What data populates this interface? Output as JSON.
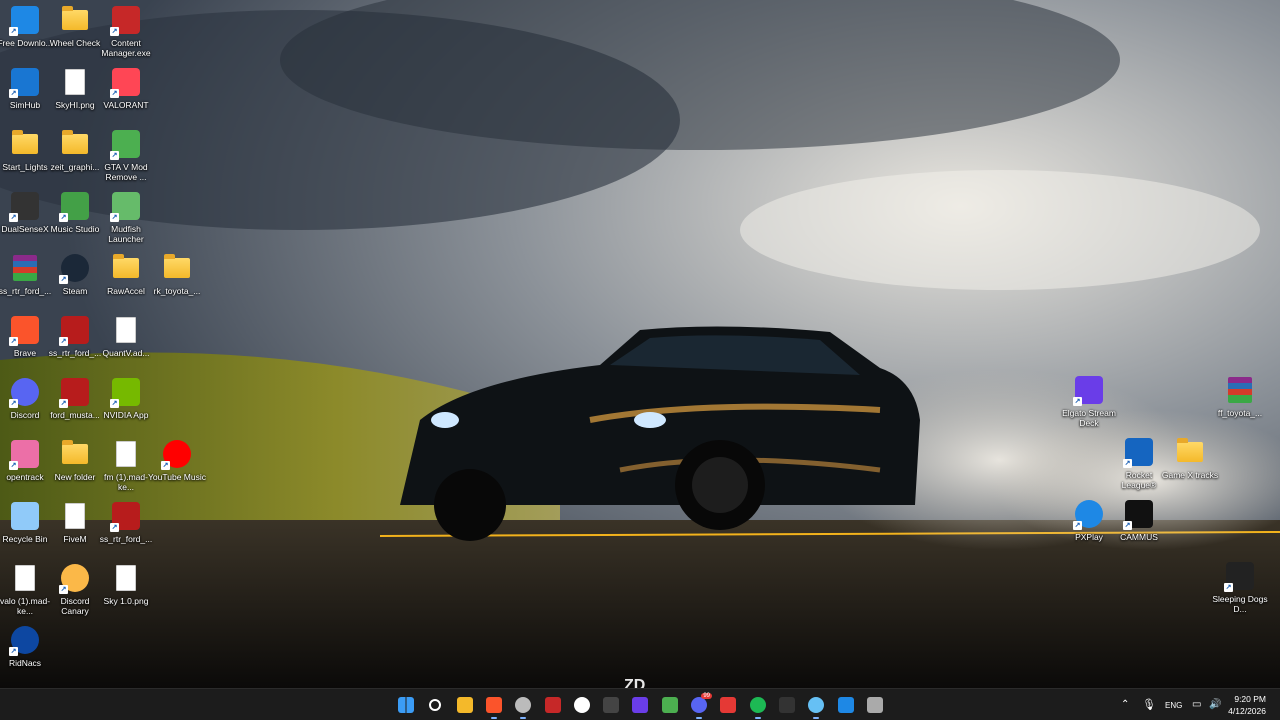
{
  "desktop": {
    "icons": [
      {
        "label": "Free Downlo...",
        "icon": "free-download-manager-icon",
        "color": "#1e88e5"
      },
      {
        "label": "Wheel Check",
        "icon": "folder-icon",
        "color": "#f4b92a"
      },
      {
        "label": "Content Manager.exe",
        "icon": "content-manager-icon",
        "color": "#c62828"
      },
      {
        "label": "SimHub",
        "icon": "simhub-icon",
        "color": "#1976d2"
      },
      {
        "label": "SkyHI.png",
        "icon": "image-file-icon",
        "color": "#ffffff"
      },
      {
        "label": "VALORANT",
        "icon": "valorant-icon",
        "color": "#ff4655"
      },
      {
        "label": "Start_Lights",
        "icon": "folder-icon",
        "color": "#f4b92a"
      },
      {
        "label": "zeit_graphi...",
        "icon": "folder-icon",
        "color": "#f4b92a"
      },
      {
        "label": "GTA V Mod Remove ...",
        "icon": "gta-v-mod-icon",
        "color": "#4caf50"
      },
      {
        "label": "DualSenseX",
        "icon": "dualsensex-icon",
        "color": "#333333"
      },
      {
        "label": "Music Studio",
        "icon": "music-studio-icon",
        "color": "#43a047"
      },
      {
        "label": "Mudfish Launcher",
        "icon": "mudfish-icon",
        "color": "#66bb6a"
      },
      {
        "label": "ss_rtr_ford_...",
        "icon": "winrar-archive-icon",
        "color": "#8b2a8a"
      },
      {
        "label": "Steam",
        "icon": "steam-icon",
        "color": "#1b2838"
      },
      {
        "label": "RawAccel",
        "icon": "folder-icon",
        "color": "#f4b92a"
      },
      {
        "label": "rk_toyota_...",
        "icon": "folder-icon",
        "color": "#f4b92a"
      },
      {
        "label": "Brave",
        "icon": "brave-icon",
        "color": "#fb542b"
      },
      {
        "label": "ss_rtr_ford_...",
        "icon": "kns-file-icon",
        "color": "#b71c1c"
      },
      {
        "label": "QuantV.ad...",
        "icon": "document-icon",
        "color": "#ffffff"
      },
      {
        "label": "Discord",
        "icon": "discord-icon",
        "color": "#5865f2"
      },
      {
        "label": "ford_musta...",
        "icon": "kns-file-icon",
        "color": "#b71c1c"
      },
      {
        "label": "NVIDIA App",
        "icon": "nvidia-icon",
        "color": "#76b900"
      },
      {
        "label": "opentrack",
        "icon": "opentrack-icon",
        "color": "#ec6fa7"
      },
      {
        "label": "New folder",
        "icon": "folder-icon",
        "color": "#f4b92a"
      },
      {
        "label": "fm (1).mad-ke...",
        "icon": "document-icon",
        "color": "#ffffff"
      },
      {
        "label": "YouTube Music",
        "icon": "youtube-music-icon",
        "color": "#ff0000"
      },
      {
        "label": "Recycle Bin",
        "icon": "recycle-bin-icon",
        "color": "#90caf9"
      },
      {
        "label": "FiveM",
        "icon": "document-icon",
        "color": "#ffffff"
      },
      {
        "label": "ss_rtr_ford_...",
        "icon": "kns-file-icon",
        "color": "#b71c1c"
      },
      {
        "label": "valo (1).mad-ke...",
        "icon": "document-icon",
        "color": "#ffffff"
      },
      {
        "label": "Discord Canary",
        "icon": "discord-canary-icon",
        "color": "#fbb848"
      },
      {
        "label": "Sky 1.0.png",
        "icon": "image-file-icon",
        "color": "#ffffff"
      },
      {
        "label": "RidNacs",
        "icon": "ridnacs-icon",
        "color": "#0d47a1"
      }
    ],
    "right_icons": [
      {
        "label": "Elgato Stream Deck",
        "icon": "stream-deck-icon",
        "color": "#6a3de8"
      },
      {
        "label": "ff_toyota_...",
        "icon": "winrar-archive-icon",
        "color": "#8b2a8a"
      },
      {
        "label": "Rocket League®",
        "icon": "rocket-league-icon",
        "color": "#1565c0"
      },
      {
        "label": "Game X tracks",
        "icon": "folder-icon",
        "color": "#f4b92a"
      },
      {
        "label": "PXPlay",
        "icon": "pxplay-icon",
        "color": "#1e88e5"
      },
      {
        "label": "CAMMUS",
        "icon": "cammus-icon",
        "color": "#111111"
      },
      {
        "label": "Sleeping Dogs D...",
        "icon": "sleeping-dogs-icon",
        "color": "#222222"
      }
    ]
  },
  "wallpaper": {
    "watermark": "ZD"
  },
  "taskbar": {
    "items": [
      {
        "name": "start-button",
        "icon": "windows-icon",
        "color": "#3b9cf5"
      },
      {
        "name": "search-button",
        "icon": "search-icon",
        "color": "#ffffff"
      },
      {
        "name": "file-explorer-button",
        "icon": "folder-icon",
        "color": "#f4b92a"
      },
      {
        "name": "brave-taskbar-button",
        "icon": "brave-icon",
        "color": "#fb542b"
      },
      {
        "name": "chrome-taskbar-button",
        "icon": "browser-icon",
        "color": "#bbbbbb"
      },
      {
        "name": "content-manager-taskbar-button",
        "icon": "content-manager-icon",
        "color": "#c62828"
      },
      {
        "name": "obs-taskbar-button",
        "icon": "obs-icon",
        "color": "#ffffff"
      },
      {
        "name": "terminal-taskbar-button",
        "icon": "terminal-icon",
        "color": "#444444"
      },
      {
        "name": "stream-deck-taskbar-button",
        "icon": "stream-deck-icon",
        "color": "#6a3de8"
      },
      {
        "name": "xbox-taskbar-button",
        "icon": "xbox-icon",
        "color": "#4caf50"
      },
      {
        "name": "discord-taskbar-button",
        "icon": "discord-icon",
        "color": "#5865f2"
      },
      {
        "name": "spotify-app-button",
        "icon": "launcher-icon",
        "color": "#e53935"
      },
      {
        "name": "spotify-taskbar-button",
        "icon": "spotify-icon",
        "color": "#1db954"
      },
      {
        "name": "game-taskbar-button",
        "icon": "game-icon",
        "color": "#333333"
      },
      {
        "name": "steam-taskbar-button",
        "icon": "steam-icon",
        "color": "#66c0f4"
      },
      {
        "name": "download-manager-taskbar-button",
        "icon": "free-download-manager-icon",
        "color": "#1e88e5"
      },
      {
        "name": "settings-taskbar-button",
        "icon": "gear-icon",
        "color": "#aaaaaa"
      }
    ],
    "discord_badge": "99",
    "tray": {
      "language": "ENG",
      "time": "9:20 PM",
      "date": "4/12/2026"
    }
  }
}
